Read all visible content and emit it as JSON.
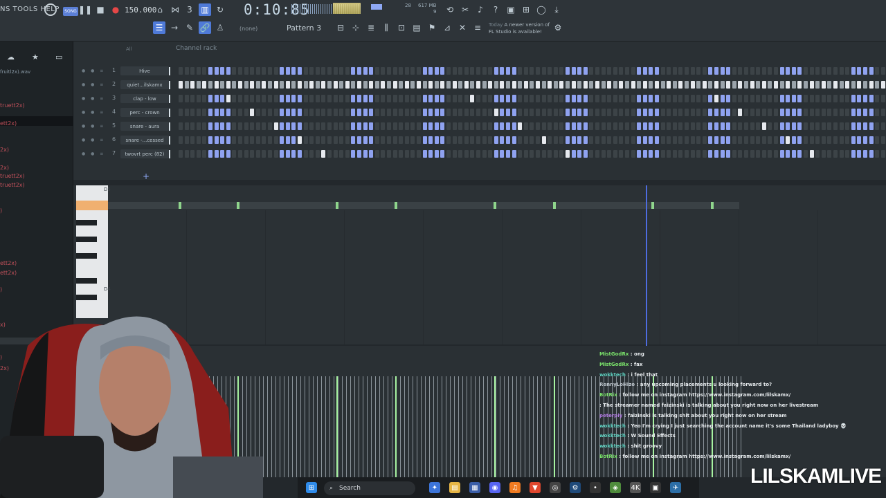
{
  "menu": {
    "text": "NS  TOOLS  HELP"
  },
  "transport": {
    "song_label": "SONG",
    "tempo": "150.000",
    "clock": "0:10:85",
    "memory_top": "617 MB",
    "memory_bottom": "9",
    "memory_count": "28"
  },
  "toolbar2": {
    "snap": "(none)",
    "pattern": "Pattern 3"
  },
  "news": {
    "date": "Today",
    "line1": "A newer version of",
    "line2": "FL Studio is available!"
  },
  "browser": {
    "wav_file": "fruitl2x).wav",
    "files": [
      "truett2x)",
      "ett2x)",
      "2x)",
      "2x)",
      "truett2x)",
      "truett2x)",
      ")",
      "ett2x)",
      "ett2x)",
      ")",
      "x)",
      ")",
      "2x)"
    ]
  },
  "rack": {
    "title": "Channel rack",
    "filter": "All",
    "channels": [
      {
        "num": "1",
        "name": "Hive"
      },
      {
        "num": "2",
        "name": "quiet...ilskamx"
      },
      {
        "num": "3",
        "name": "clap - low"
      },
      {
        "num": "4",
        "name": "perc - crown"
      },
      {
        "num": "5",
        "name": "snare - aura"
      },
      {
        "num": "6",
        "name": "snare -...cessed"
      },
      {
        "num": "7",
        "name": "twovrt perc (82)"
      }
    ]
  },
  "piano_roll": {
    "key_top": "D5",
    "key_bottom": "D4"
  },
  "chat": [
    {
      "user": "MistGodRx",
      "text": "ong",
      "color": "#7be36b"
    },
    {
      "user": "MistGodRx",
      "text": "fax",
      "color": "#7be36b"
    },
    {
      "user": "wokktech",
      "text": "i feel that",
      "color": "#5fd3c2"
    },
    {
      "user": "RennyLoHizo",
      "text": "any upcoming placements u looking forward to?",
      "color": "#c0c8cf"
    },
    {
      "user": "BotRix",
      "text": "follow me on instagram https://www.instagram.com/lilskamx/",
      "color": "#7be36b"
    },
    {
      "user": "",
      "text": "The streamer named faizinski is talking about you right now on her livestream",
      "color": "#e04a4a"
    },
    {
      "user": "peterpiy",
      "text": "faizinski is talking shit about you right now on her stream",
      "color": "#b07be0"
    },
    {
      "user": "wokktech",
      "text": "Yeo I'm crying I just searching the account name it's some Thailand ladyboy 💀",
      "color": "#5fd3c2"
    },
    {
      "user": "wokktech",
      "text": "W Sound Effects",
      "color": "#5fd3c2"
    },
    {
      "user": "wokktech",
      "text": "shit groovy",
      "color": "#5fd3c2"
    },
    {
      "user": "BotRix",
      "text": "follow me on instagram https://www.instagram.com/lilskamx/",
      "color": "#7be36b"
    }
  ],
  "taskbar": {
    "search": "Search"
  },
  "brand": "LILSKAMLIVE"
}
